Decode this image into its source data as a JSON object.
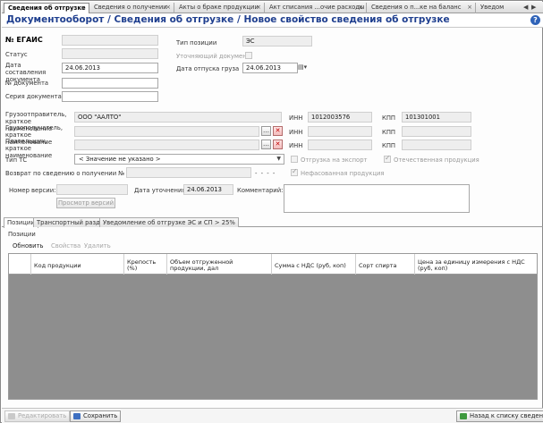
{
  "tabs": [
    {
      "label": "Сведения об отгрузке",
      "active": true
    },
    {
      "label": "Сведения о получении",
      "active": false
    },
    {
      "label": "Акты о браке продукции",
      "active": false
    },
    {
      "label": "Акт списания ...очие расходы",
      "active": false
    },
    {
      "label": "Сведения о п...ке на баланс",
      "active": false
    },
    {
      "label": "Уведом",
      "active": false
    }
  ],
  "header": {
    "title": "Документооборот  / Сведения об отгрузке / Новое свойство сведения об отгрузке"
  },
  "form": {
    "egais_label": "№ ЕГАИС",
    "status_label": "Статус",
    "date_compiled_label": "Дата составления документа",
    "date_compiled_value": "24.06.2013",
    "doc_number_label": "№ документа",
    "doc_series_label": "Серия  документа",
    "position_type_label": "Тип позиции",
    "position_type_value": "ЭС",
    "clarifying_doc_label": "Уточняющий документ",
    "shipment_date_label": "Дата отпуска груза",
    "shipment_date_value": "24.06.2013",
    "shipper_label": "Грузоотправитель, краткое наименование",
    "shipper_value": "ООО \"ААЛТО\"",
    "inn_label": "ИНН",
    "shipper_inn": "1012003576",
    "kpp_label": "КПП",
    "shipper_kpp": "101301001",
    "consignee_label": "Грузополучатель, краткое наименование",
    "payer_label": "Плательщик, краткое наименование",
    "vehicle_type_label": "Тип ТС",
    "vehicle_type_value": "< Значение не указано >",
    "export_label": "Отгрузка на экспорт",
    "domestic_label": "Отечественная продукция",
    "return_label": "Возврат по сведению о получении №",
    "return_dots": "- - - -",
    "unpackaged_label": "Нефасованная продукция",
    "version_label": "Номер версии:",
    "clarify_date_label": "Дата уточнения:",
    "clarify_date_value": "24.06.2013",
    "comment_label": "Комментарий:",
    "view_versions_button": "Просмотр версий"
  },
  "section_tabs": [
    {
      "label": "Позиции",
      "active": true
    },
    {
      "label": "Транспортный раздел",
      "active": false
    },
    {
      "label": "Уведомление об отгрузке ЭС и СП > 25%",
      "active": false
    }
  ],
  "grid": {
    "label": "Позиции",
    "toolbar": {
      "refresh": "Обновить",
      "properties": "Свойства",
      "delete": "Удалить"
    },
    "columns": [
      "Код продукции",
      "Крепость (%)",
      "Объем отгруженной продукции, дал",
      "Сумма с НДС (руб, коп)",
      "Сорт спирта",
      "Цена за единицу измерения с НДС (руб, коп)"
    ]
  },
  "footer": {
    "edit": "Редактировать",
    "save": "Сохранить",
    "back": "Назад к списку сведений"
  }
}
